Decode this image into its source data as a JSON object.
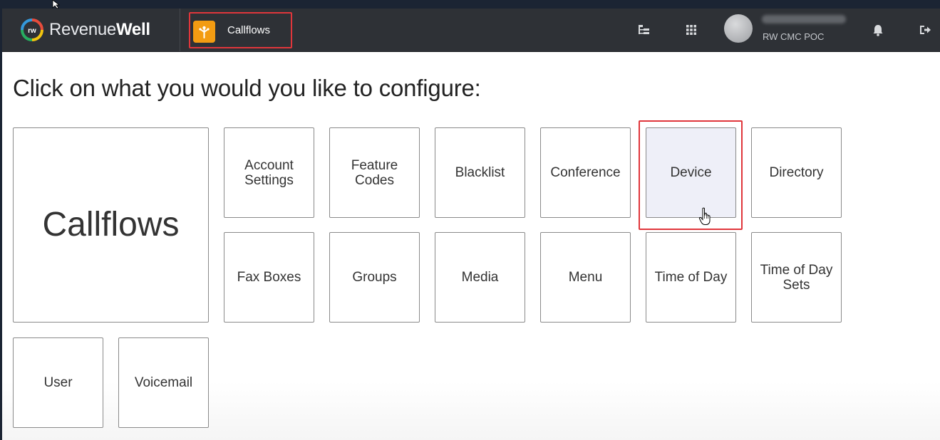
{
  "brand": {
    "name_light": "Revenue",
    "name_bold": "Well",
    "logo_text": "rw"
  },
  "navbar": {
    "app_label": "Callflows",
    "account_name": "RW CMC POC",
    "icons": [
      "hierarchy-icon",
      "apps-grid-icon",
      "bell-icon",
      "logout-icon"
    ]
  },
  "page": {
    "title": "Click on what you would you like to configure:"
  },
  "tiles": [
    {
      "label": "Callflows"
    },
    {
      "label": "Account\nSettings"
    },
    {
      "label": "Feature\nCodes"
    },
    {
      "label": "Blacklist"
    },
    {
      "label": "Conference"
    },
    {
      "label": "Device"
    },
    {
      "label": "Directory"
    },
    {
      "label": "Fax Boxes"
    },
    {
      "label": "Groups"
    },
    {
      "label": "Media"
    },
    {
      "label": "Menu"
    },
    {
      "label": "Time of Day"
    },
    {
      "label": "Time of Day\nSets"
    },
    {
      "label": "User"
    },
    {
      "label": "Voicemail"
    }
  ],
  "colors": {
    "navbar_bg": "#2e3136",
    "highlight": "#e0363b",
    "app_icon": "#f39c12",
    "hover_tile": "#eeeff8"
  }
}
